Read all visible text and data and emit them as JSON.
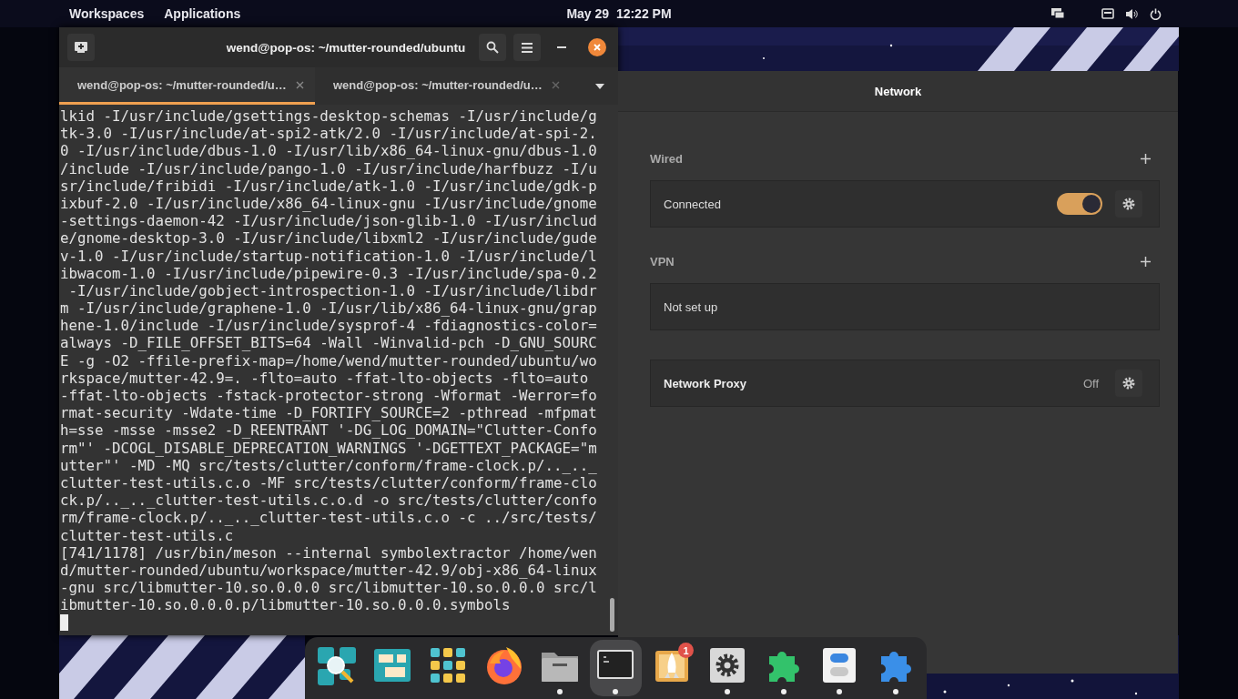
{
  "top_bar": {
    "menus": [
      "Workspaces",
      "Applications"
    ],
    "clock": "May 29  12:22 PM"
  },
  "terminal": {
    "title": "wend@pop-os: ~/mutter-rounded/ubuntu",
    "tabs": [
      {
        "label": "wend@pop-os: ~/mutter-rounded/u…",
        "selected": true
      },
      {
        "label": "wend@pop-os: ~/mutter-rounded/u…",
        "selected": false
      }
    ],
    "lines": [
      "lkid -I/usr/include/gsettings-desktop-schemas -I/usr/include/g",
      "tk-3.0 -I/usr/include/at-spi2-atk/2.0 -I/usr/include/at-spi-2.",
      "0 -I/usr/include/dbus-1.0 -I/usr/lib/x86_64-linux-gnu/dbus-1.0",
      "/include -I/usr/include/pango-1.0 -I/usr/include/harfbuzz -I/u",
      "sr/include/fribidi -I/usr/include/atk-1.0 -I/usr/include/gdk-p",
      "ixbuf-2.0 -I/usr/include/x86_64-linux-gnu -I/usr/include/gnome",
      "-settings-daemon-42 -I/usr/include/json-glib-1.0 -I/usr/includ",
      "e/gnome-desktop-3.0 -I/usr/include/libxml2 -I/usr/include/gude",
      "v-1.0 -I/usr/include/startup-notification-1.0 -I/usr/include/l",
      "ibwacom-1.0 -I/usr/include/pipewire-0.3 -I/usr/include/spa-0.2",
      " -I/usr/include/gobject-introspection-1.0 -I/usr/include/libdr",
      "m -I/usr/include/graphene-1.0 -I/usr/lib/x86_64-linux-gnu/grap",
      "hene-1.0/include -I/usr/include/sysprof-4 -fdiagnostics-color=",
      "always -D_FILE_OFFSET_BITS=64 -Wall -Winvalid-pch -D_GNU_SOURC",
      "E -g -O2 -ffile-prefix-map=/home/wend/mutter-rounded/ubuntu/wo",
      "rkspace/mutter-42.9=. -flto=auto -ffat-lto-objects -flto=auto",
      "-ffat-lto-objects -fstack-protector-strong -Wformat -Werror=fo",
      "rmat-security -Wdate-time -D_FORTIFY_SOURCE=2 -pthread -mfpmat",
      "h=sse -msse -msse2 -D_REENTRANT '-DG_LOG_DOMAIN=\"Clutter-Confo",
      "rm\"' -DCOGL_DISABLE_DEPRECATION_WARNINGS '-DGETTEXT_PACKAGE=\"m",
      "utter\"' -MD -MQ src/tests/clutter/conform/frame-clock.p/.._.._",
      "clutter-test-utils.c.o -MF src/tests/clutter/conform/frame-clo",
      "ck.p/.._.._clutter-test-utils.c.o.d -o src/tests/clutter/confo",
      "rm/frame-clock.p/.._.._clutter-test-utils.c.o -c ../src/tests/",
      "clutter-test-utils.c",
      "[741/1178] /usr/bin/meson --internal symbolextractor /home/wen",
      "d/mutter-rounded/ubuntu/workspace/mutter-42.9/obj-x86_64-linux",
      "-gnu src/libmutter-10.so.0.0.0 src/libmutter-10.so.0.0.0 src/l",
      "ibmutter-10.so.0.0.0.p/libmutter-10.so.0.0.0.symbols"
    ]
  },
  "network": {
    "title": "Network",
    "sections": [
      {
        "heading": "Wired",
        "rows": [
          {
            "kind": "toggle",
            "label": "Connected",
            "on": true
          }
        ]
      },
      {
        "heading": "VPN",
        "rows": [
          {
            "kind": "empty",
            "label": "Not set up"
          }
        ]
      },
      {
        "rows": [
          {
            "kind": "proxy",
            "label": "Network Proxy",
            "value": "Off"
          }
        ]
      }
    ]
  },
  "dock": {
    "items": [
      {
        "running": false,
        "selected": false
      },
      {
        "running": false,
        "selected": false
      },
      {
        "running": false,
        "selected": false
      },
      {
        "running": false,
        "selected": false
      },
      {
        "running": true,
        "selected": false
      },
      {
        "running": true,
        "selected": true
      },
      {
        "running": false,
        "selected": false,
        "badge": "1"
      },
      {
        "running": true,
        "selected": false
      },
      {
        "running": true,
        "selected": false
      },
      {
        "running": true,
        "selected": false
      },
      {
        "running": true,
        "selected": false
      }
    ]
  }
}
